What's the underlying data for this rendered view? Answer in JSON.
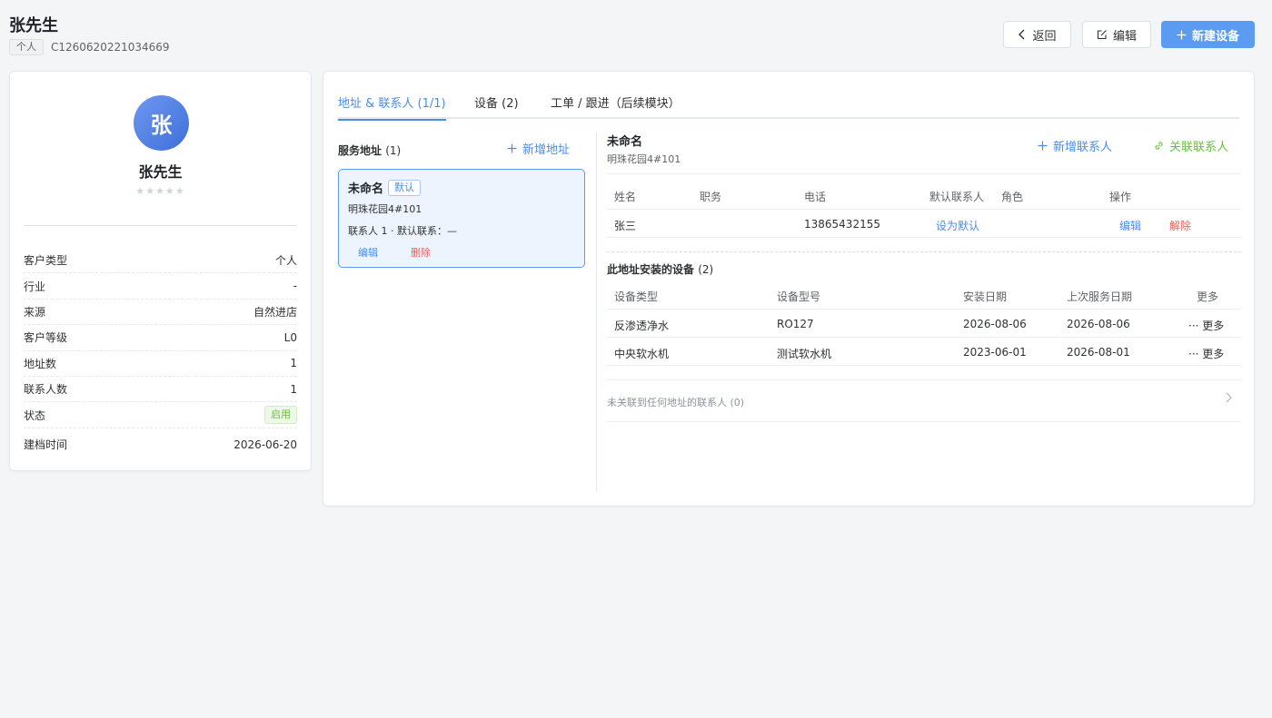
{
  "header": {
    "title": "张先生",
    "type_tag": "个人",
    "customer_id": "C1260620221034669",
    "buttons": {
      "back": "返回",
      "edit": "编辑",
      "new_device": "新建设备"
    }
  },
  "profile": {
    "avatar_char": "张",
    "name": "张先生",
    "stars": "★★★★★",
    "rating": 0,
    "info": [
      {
        "label": "客户类型",
        "value": "个人"
      },
      {
        "label": "行业",
        "value": "-"
      },
      {
        "label": "来源",
        "value": "自然进店"
      },
      {
        "label": "客户等级",
        "value": "L0"
      },
      {
        "label": "地址数",
        "value": "1"
      },
      {
        "label": "联系人数",
        "value": "1"
      },
      {
        "label": "状态",
        "value": "启用"
      },
      {
        "label": "建档时间",
        "value": "2026-06-20"
      }
    ]
  },
  "tabs": [
    {
      "label": "地址 & 联系人 (1/1)",
      "active": true
    },
    {
      "label": "设备 (2)",
      "active": false
    },
    {
      "label": "工单 / 跟进（后续模块）",
      "active": false
    }
  ],
  "addresses": {
    "title": "服务地址",
    "count": "(1)",
    "add_label": "新增地址",
    "items": [
      {
        "name": "未命名",
        "default_tag": "默认",
        "address": "明珠花园4#101",
        "contacts_meta": "联系人 1 · 默认联系：—",
        "edit": "编辑",
        "delete": "删除"
      }
    ]
  },
  "detail": {
    "name": "未命名",
    "address": "明珠花园4#101",
    "add_contact": "新增联系人",
    "link_contact": "关联联系人",
    "contacts_table": {
      "headers": [
        "姓名",
        "职务",
        "电话",
        "默认联系人",
        "角色",
        "操作"
      ],
      "rows": [
        {
          "name": "张三",
          "title": "",
          "phone": "13865432155",
          "default_action": "设为默认",
          "role": "",
          "edit": "编辑",
          "remove": "解除"
        }
      ]
    },
    "devices_title": "此地址安装的设备",
    "devices_count": "(2)",
    "devices_table": {
      "headers": [
        "设备类型",
        "设备型号",
        "安装日期",
        "上次服务日期",
        "更多"
      ],
      "rows": [
        {
          "type": "反渗透净水",
          "model": "RO127",
          "install": "2026-08-06",
          "last_service": "2026-08-06",
          "more": "更多"
        },
        {
          "type": "中央软水机",
          "model": "测试软水机",
          "install": "2023-06-01",
          "last_service": "2026-08-01",
          "more": "更多"
        }
      ]
    },
    "unlinked_contacts": "未关联到任何地址的联系人 (0)"
  },
  "colors": {
    "primary": "#5b9cf2",
    "link": "#4a8de9",
    "danger": "#e8605f",
    "success": "#67c23a",
    "avatar": "#4a7be3"
  }
}
